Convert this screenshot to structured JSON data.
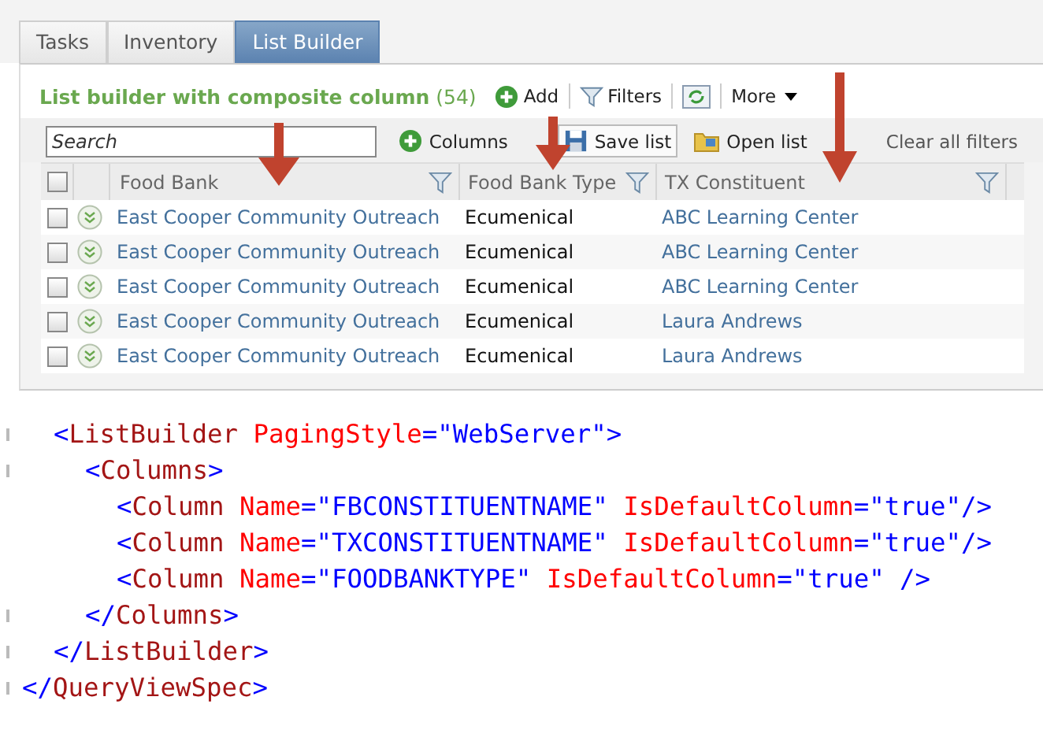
{
  "tabs": [
    {
      "label": "Tasks",
      "selected": false
    },
    {
      "label": "Inventory",
      "selected": false
    },
    {
      "label": "List Builder",
      "selected": true
    }
  ],
  "list": {
    "title": "List builder with composite column",
    "count": "(54)",
    "toolbar": [
      {
        "kind": "add",
        "label": "Add"
      },
      {
        "kind": "filter",
        "label": "Filters"
      },
      {
        "kind": "refresh"
      },
      {
        "kind": "more",
        "label": "More"
      }
    ],
    "search": {
      "placeholder": "Search"
    },
    "actions": [
      {
        "kind": "columns",
        "label": "Columns"
      },
      {
        "kind": "save",
        "label": "Save list"
      },
      {
        "kind": "open",
        "label": "Open list"
      },
      {
        "kind": "clear",
        "label": "Clear all filters"
      }
    ],
    "select_all": {
      "checked": false
    },
    "columns": [
      {
        "label": "Food Bank"
      },
      {
        "label": "Food Bank Type"
      },
      {
        "label": "TX Constituent"
      }
    ],
    "rows": [
      {
        "checked": false,
        "cells": [
          "East Cooper Community Outreach",
          "Ecumenical",
          "ABC Learning Center"
        ]
      },
      {
        "checked": false,
        "cells": [
          "East Cooper Community Outreach",
          "Ecumenical",
          "ABC Learning Center"
        ]
      },
      {
        "checked": false,
        "cells": [
          "East Cooper Community Outreach",
          "Ecumenical",
          "ABC Learning Center"
        ]
      },
      {
        "checked": false,
        "cells": [
          "East Cooper Community Outreach",
          "Ecumenical",
          "Laura Andrews"
        ]
      },
      {
        "checked": false,
        "cells": [
          "East Cooper Community Outreach",
          "Ecumenical",
          "Laura Andrews"
        ]
      }
    ]
  },
  "code": {
    "children": [
      {
        "line": [
          {
            "kind": "punct",
            "text": "<"
          },
          {
            "kind": "tag",
            "text": "ListBuilder"
          },
          {
            "kind": "attr",
            "text": " PagingStyle"
          },
          {
            "kind": "punct",
            "text": "=\"WebServer\">"
          }
        ],
        "children": [
          {
            "line": [
              {
                "kind": "punct",
                "text": "<"
              },
              {
                "kind": "tag",
                "text": "Columns"
              },
              {
                "kind": "punct",
                "text": ">"
              }
            ],
            "children": [
              {
                "line": [
                  {
                    "kind": "punct",
                    "text": "<"
                  },
                  {
                    "kind": "tag",
                    "text": "Column"
                  },
                  {
                    "kind": "attr",
                    "text": " Name"
                  },
                  {
                    "kind": "punct",
                    "text": "=\"FBCONSTITUENTNAME\""
                  },
                  {
                    "kind": "attr",
                    "text": " IsDefaultColumn"
                  },
                  {
                    "kind": "punct",
                    "text": "=\"true\"/>"
                  }
                ]
              },
              {
                "line": [
                  {
                    "kind": "punct",
                    "text": "<"
                  },
                  {
                    "kind": "tag",
                    "text": "Column"
                  },
                  {
                    "kind": "attr",
                    "text": " Name"
                  },
                  {
                    "kind": "punct",
                    "text": "=\"TXCONSTITUENTNAME\""
                  },
                  {
                    "kind": "attr",
                    "text": " IsDefaultColumn"
                  },
                  {
                    "kind": "punct",
                    "text": "=\"true\"/>"
                  }
                ]
              },
              {
                "line": [
                  {
                    "kind": "punct",
                    "text": "<"
                  },
                  {
                    "kind": "tag",
                    "text": "Column"
                  },
                  {
                    "kind": "attr",
                    "text": " Name"
                  },
                  {
                    "kind": "punct",
                    "text": "=\"FOODBANKTYPE\""
                  },
                  {
                    "kind": "attr",
                    "text": " IsDefaultColumn"
                  },
                  {
                    "kind": "punct",
                    "text": "=\"true\" />"
                  }
                ]
              }
            ],
            "end": [
              {
                "kind": "punct",
                "text": "</"
              },
              {
                "kind": "tag",
                "text": "Columns"
              },
              {
                "kind": "punct",
                "text": ">"
              }
            ]
          }
        ],
        "end": [
          {
            "kind": "punct",
            "text": "</"
          },
          {
            "kind": "tag",
            "text": "ListBuilder"
          },
          {
            "kind": "punct",
            "text": ">"
          }
        ]
      }
    ],
    "end": [
      {
        "kind": "punct",
        "text": "</"
      },
      {
        "kind": "tag",
        "text": "QueryViewSpec"
      },
      {
        "kind": "punct",
        "text": ">"
      }
    ]
  }
}
